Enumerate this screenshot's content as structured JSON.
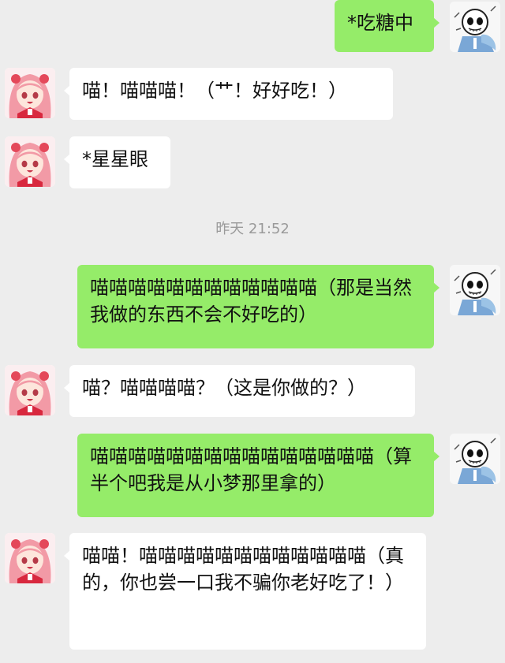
{
  "timestamp": "昨天 21:52",
  "colors": {
    "background": "#ededed",
    "bubble_self": "#95ec69",
    "bubble_other": "#ffffff",
    "timestamp_text": "#9a9a9a"
  },
  "avatars": {
    "other": "pink-hair-anime-girl-avatar",
    "self": "skeleton-character-avatar"
  },
  "messages": [
    {
      "sender": "self",
      "text": "*吃糖中"
    },
    {
      "sender": "other",
      "text": "喵！喵喵喵！（艹！好好吃！）"
    },
    {
      "sender": "other",
      "text": "*星星眼"
    },
    {
      "sender": "self",
      "text": "喵喵喵喵喵喵喵喵喵喵喵喵（那是当然我做的东西不会不好吃的）"
    },
    {
      "sender": "other",
      "text": "喵？喵喵喵喵？（这是你做的？）"
    },
    {
      "sender": "self",
      "text": "喵喵喵喵喵喵喵喵喵喵喵喵喵喵喵（算半个吧我是从小梦那里拿的）"
    },
    {
      "sender": "other",
      "text": "喵喵！喵喵喵喵喵喵喵喵喵喵喵喵（真的，你也尝一口我不骗你老好吃了！）"
    }
  ]
}
